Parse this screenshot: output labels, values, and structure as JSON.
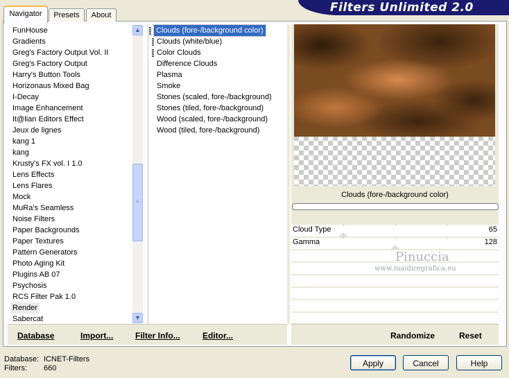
{
  "tabs": [
    "Navigator",
    "Presets",
    "About"
  ],
  "banner_title": "Filters Unlimited 2.0",
  "categories": {
    "items": [
      "FunHouse",
      "Gradients",
      "Greg's Factory Output Vol. II",
      "Greg's Factory Output",
      "Harry's Button Tools",
      "Horizonaus Mixed Bag",
      "I-Decay",
      "Image Enhancement",
      "It@lian Editors Effect",
      "Jeux de lignes",
      "kang 1",
      "kang",
      "Krusty's FX vol. I 1.0",
      "Lens Effects",
      "Lens Flares",
      "Mock",
      "MuRa's Seamless",
      "Noise Filters",
      "Paper Backgrounds",
      "Paper Textures",
      "Pattern Generators",
      "Photo Aging Kit",
      "Plugins AB 07",
      "Psychosis",
      "RCS Filter Pak 1.0",
      "Render",
      "Sabercat"
    ],
    "selected": "Render"
  },
  "filters": {
    "items": [
      "Clouds (fore-/background color)",
      "Clouds (white/blue)",
      "Color Clouds",
      "Difference Clouds",
      "Plasma",
      "Smoke",
      "Stones (scaled, fore-/background)",
      "Stones (tiled, fore-/background)",
      "Wood (scaled, fore-/background)",
      "Wood (tiled, fore-/background)"
    ],
    "selected": "Clouds (fore-/background color)"
  },
  "left_buttons": {
    "database": "Database",
    "import": "Import...",
    "filter_info": "Filter Info...",
    "editor": "Editor..."
  },
  "preview": {
    "filter_name": "Clouds (fore-/background color)"
  },
  "parameters": [
    {
      "label": "Cloud Type",
      "value": "65",
      "level": 0.25
    },
    {
      "label": "Gamma",
      "value": "128",
      "level": 0.5
    }
  ],
  "watermark": {
    "name": "Pinuccia",
    "site": "www.maidiregrafica.eu"
  },
  "right_buttons": {
    "randomize": "Randomize",
    "reset": "Reset"
  },
  "status": {
    "database_label": "Database:",
    "database_value": "ICNET-Filters",
    "filters_label": "Filters:",
    "filters_value": "660"
  },
  "dialog_buttons": {
    "apply": "Apply",
    "cancel": "Cancel",
    "help": "Help"
  },
  "colors": {
    "banner": "#1a1a6e",
    "selection": "#316ac5",
    "tab_highlight": "#f7b64a"
  }
}
